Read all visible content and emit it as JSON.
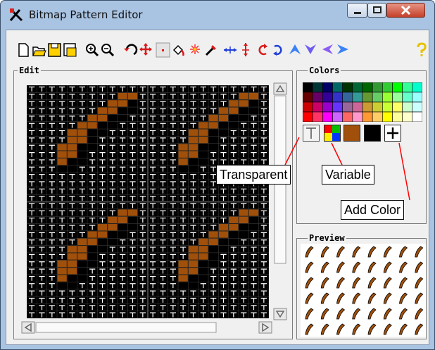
{
  "window": {
    "title": "Bitmap Pattern Editor"
  },
  "toolbar": {
    "tools": [
      "new-icon",
      "open-icon",
      "save-icon",
      "save-as-icon",
      "zoom-in-icon",
      "zoom-out-icon",
      "rotate-icon",
      "move-icon",
      "dot-icon",
      "fill-icon",
      "spray-icon",
      "eyedropper-icon",
      "flip-horizontal-icon",
      "flip-vertical-icon",
      "rotate-left-icon",
      "rotate-right-icon",
      "shift-up-icon",
      "shift-down-icon",
      "shift-left-icon",
      "shift-right-icon",
      "help-icon"
    ]
  },
  "edit": {
    "label": "Edit",
    "pattern_rows": [
      "TTTTTTTTTTTT",
      "TTTTTTTTT##T",
      "TTTTTTTT##:T",
      "TTTTTTT##::T",
      "TTTTTT##::TT",
      "TTTTT##::TTT",
      "TTTT##::TTTT",
      "TTTT##:TTTTT",
      "TTT##::TTTTT",
      "TTT##:TTTTTT",
      "TTT#::TTTTTT",
      "TTT::TTTTTTT",
      "TTTTTTTTTTTT",
      "TTTTTTTTTTTT",
      "TTTTTTTTTTTT",
      "TTTTTTTTTTTT"
    ]
  },
  "colors": {
    "label": "Colors",
    "palette_rows": [
      [
        "#000000",
        "#003333",
        "#000066",
        "#006666",
        "#003300",
        "#006633",
        "#006600",
        "#339933",
        "#33cc33",
        "#00ff00",
        "#33ff99",
        "#00ffcc"
      ],
      [
        "#660000",
        "#660066",
        "#330099",
        "#3333cc",
        "#336699",
        "#339999",
        "#669933",
        "#66cc66",
        "#99ff33",
        "#99ff99",
        "#66ffcc",
        "#99ffff"
      ],
      [
        "#cc0000",
        "#cc0066",
        "#9900cc",
        "#6633ff",
        "#996699",
        "#cc6699",
        "#cc9933",
        "#cccc33",
        "#ccff33",
        "#ffff66",
        "#ccffcc",
        "#ccffff"
      ],
      [
        "#ff0000",
        "#ff3366",
        "#ff00ff",
        "#cc66ff",
        "#ff6666",
        "#ff99cc",
        "#ff9933",
        "#ffcc66",
        "#ffff00",
        "#ffff99",
        "#ffffcc",
        "#ffffff"
      ]
    ],
    "swatches": {
      "brown": "#a0500a",
      "black": "#000000",
      "variable_colors": [
        "#ff0000",
        "#00c000",
        "#0033ff",
        "#ffee00"
      ]
    }
  },
  "callouts": {
    "transparent": "Transparent",
    "variable": "Variable",
    "add_color": "Add Color"
  },
  "preview": {
    "label": "Preview",
    "motif_color": "#a0500a",
    "columns": 8,
    "rows": 6
  }
}
